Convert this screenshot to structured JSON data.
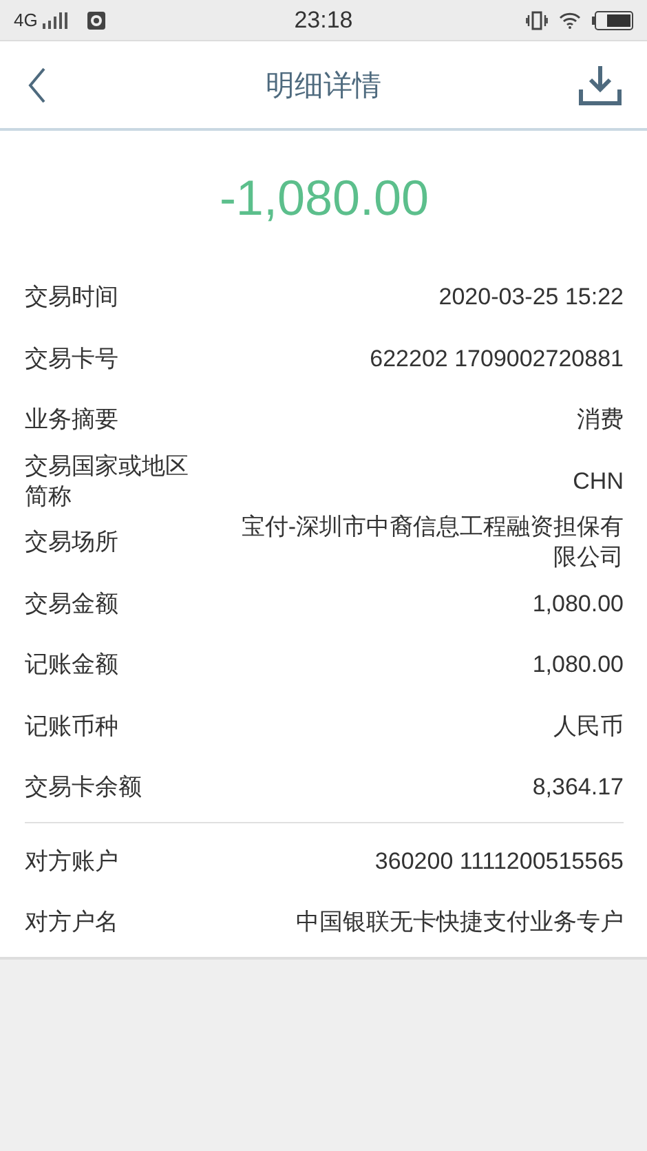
{
  "status_bar": {
    "network": "4G",
    "time": "23:18"
  },
  "header": {
    "title": "明细详情"
  },
  "amount": "-1,080.00",
  "sections": [
    {
      "rows": [
        {
          "label": "交易时间",
          "value": "2020-03-25 15:22"
        },
        {
          "label": "交易卡号",
          "value": "622202 1709002720881"
        },
        {
          "label": "业务摘要",
          "value": "消费"
        },
        {
          "label": "交易国家或地区简称",
          "value": "CHN"
        },
        {
          "label": "交易场所",
          "value": "宝付-深圳市中裔信息工程融资担保有限公司"
        },
        {
          "label": "交易金额",
          "value": "1,080.00"
        },
        {
          "label": "记账金额",
          "value": "1,080.00"
        },
        {
          "label": "记账币种",
          "value": "人民币"
        },
        {
          "label": "交易卡余额",
          "value": "8,364.17"
        }
      ]
    },
    {
      "rows": [
        {
          "label": "对方账户",
          "value": "360200 1111200515565"
        },
        {
          "label": "对方户名",
          "value": "中国银联无卡快捷支付业务专户"
        }
      ]
    }
  ]
}
